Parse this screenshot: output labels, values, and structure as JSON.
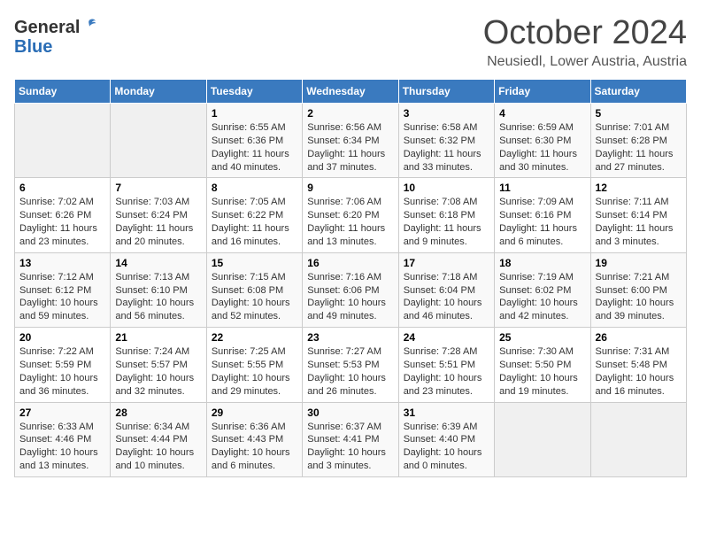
{
  "header": {
    "logo_general": "General",
    "logo_blue": "Blue",
    "month_title": "October 2024",
    "location": "Neusiedl, Lower Austria, Austria"
  },
  "weekdays": [
    "Sunday",
    "Monday",
    "Tuesday",
    "Wednesday",
    "Thursday",
    "Friday",
    "Saturday"
  ],
  "weeks": [
    [
      {
        "day": "",
        "sunrise": "",
        "sunset": "",
        "daylight": ""
      },
      {
        "day": "",
        "sunrise": "",
        "sunset": "",
        "daylight": ""
      },
      {
        "day": "1",
        "sunrise": "Sunrise: 6:55 AM",
        "sunset": "Sunset: 6:36 PM",
        "daylight": "Daylight: 11 hours and 40 minutes."
      },
      {
        "day": "2",
        "sunrise": "Sunrise: 6:56 AM",
        "sunset": "Sunset: 6:34 PM",
        "daylight": "Daylight: 11 hours and 37 minutes."
      },
      {
        "day": "3",
        "sunrise": "Sunrise: 6:58 AM",
        "sunset": "Sunset: 6:32 PM",
        "daylight": "Daylight: 11 hours and 33 minutes."
      },
      {
        "day": "4",
        "sunrise": "Sunrise: 6:59 AM",
        "sunset": "Sunset: 6:30 PM",
        "daylight": "Daylight: 11 hours and 30 minutes."
      },
      {
        "day": "5",
        "sunrise": "Sunrise: 7:01 AM",
        "sunset": "Sunset: 6:28 PM",
        "daylight": "Daylight: 11 hours and 27 minutes."
      }
    ],
    [
      {
        "day": "6",
        "sunrise": "Sunrise: 7:02 AM",
        "sunset": "Sunset: 6:26 PM",
        "daylight": "Daylight: 11 hours and 23 minutes."
      },
      {
        "day": "7",
        "sunrise": "Sunrise: 7:03 AM",
        "sunset": "Sunset: 6:24 PM",
        "daylight": "Daylight: 11 hours and 20 minutes."
      },
      {
        "day": "8",
        "sunrise": "Sunrise: 7:05 AM",
        "sunset": "Sunset: 6:22 PM",
        "daylight": "Daylight: 11 hours and 16 minutes."
      },
      {
        "day": "9",
        "sunrise": "Sunrise: 7:06 AM",
        "sunset": "Sunset: 6:20 PM",
        "daylight": "Daylight: 11 hours and 13 minutes."
      },
      {
        "day": "10",
        "sunrise": "Sunrise: 7:08 AM",
        "sunset": "Sunset: 6:18 PM",
        "daylight": "Daylight: 11 hours and 9 minutes."
      },
      {
        "day": "11",
        "sunrise": "Sunrise: 7:09 AM",
        "sunset": "Sunset: 6:16 PM",
        "daylight": "Daylight: 11 hours and 6 minutes."
      },
      {
        "day": "12",
        "sunrise": "Sunrise: 7:11 AM",
        "sunset": "Sunset: 6:14 PM",
        "daylight": "Daylight: 11 hours and 3 minutes."
      }
    ],
    [
      {
        "day": "13",
        "sunrise": "Sunrise: 7:12 AM",
        "sunset": "Sunset: 6:12 PM",
        "daylight": "Daylight: 10 hours and 59 minutes."
      },
      {
        "day": "14",
        "sunrise": "Sunrise: 7:13 AM",
        "sunset": "Sunset: 6:10 PM",
        "daylight": "Daylight: 10 hours and 56 minutes."
      },
      {
        "day": "15",
        "sunrise": "Sunrise: 7:15 AM",
        "sunset": "Sunset: 6:08 PM",
        "daylight": "Daylight: 10 hours and 52 minutes."
      },
      {
        "day": "16",
        "sunrise": "Sunrise: 7:16 AM",
        "sunset": "Sunset: 6:06 PM",
        "daylight": "Daylight: 10 hours and 49 minutes."
      },
      {
        "day": "17",
        "sunrise": "Sunrise: 7:18 AM",
        "sunset": "Sunset: 6:04 PM",
        "daylight": "Daylight: 10 hours and 46 minutes."
      },
      {
        "day": "18",
        "sunrise": "Sunrise: 7:19 AM",
        "sunset": "Sunset: 6:02 PM",
        "daylight": "Daylight: 10 hours and 42 minutes."
      },
      {
        "day": "19",
        "sunrise": "Sunrise: 7:21 AM",
        "sunset": "Sunset: 6:00 PM",
        "daylight": "Daylight: 10 hours and 39 minutes."
      }
    ],
    [
      {
        "day": "20",
        "sunrise": "Sunrise: 7:22 AM",
        "sunset": "Sunset: 5:59 PM",
        "daylight": "Daylight: 10 hours and 36 minutes."
      },
      {
        "day": "21",
        "sunrise": "Sunrise: 7:24 AM",
        "sunset": "Sunset: 5:57 PM",
        "daylight": "Daylight: 10 hours and 32 minutes."
      },
      {
        "day": "22",
        "sunrise": "Sunrise: 7:25 AM",
        "sunset": "Sunset: 5:55 PM",
        "daylight": "Daylight: 10 hours and 29 minutes."
      },
      {
        "day": "23",
        "sunrise": "Sunrise: 7:27 AM",
        "sunset": "Sunset: 5:53 PM",
        "daylight": "Daylight: 10 hours and 26 minutes."
      },
      {
        "day": "24",
        "sunrise": "Sunrise: 7:28 AM",
        "sunset": "Sunset: 5:51 PM",
        "daylight": "Daylight: 10 hours and 23 minutes."
      },
      {
        "day": "25",
        "sunrise": "Sunrise: 7:30 AM",
        "sunset": "Sunset: 5:50 PM",
        "daylight": "Daylight: 10 hours and 19 minutes."
      },
      {
        "day": "26",
        "sunrise": "Sunrise: 7:31 AM",
        "sunset": "Sunset: 5:48 PM",
        "daylight": "Daylight: 10 hours and 16 minutes."
      }
    ],
    [
      {
        "day": "27",
        "sunrise": "Sunrise: 6:33 AM",
        "sunset": "Sunset: 4:46 PM",
        "daylight": "Daylight: 10 hours and 13 minutes."
      },
      {
        "day": "28",
        "sunrise": "Sunrise: 6:34 AM",
        "sunset": "Sunset: 4:44 PM",
        "daylight": "Daylight: 10 hours and 10 minutes."
      },
      {
        "day": "29",
        "sunrise": "Sunrise: 6:36 AM",
        "sunset": "Sunset: 4:43 PM",
        "daylight": "Daylight: 10 hours and 6 minutes."
      },
      {
        "day": "30",
        "sunrise": "Sunrise: 6:37 AM",
        "sunset": "Sunset: 4:41 PM",
        "daylight": "Daylight: 10 hours and 3 minutes."
      },
      {
        "day": "31",
        "sunrise": "Sunrise: 6:39 AM",
        "sunset": "Sunset: 4:40 PM",
        "daylight": "Daylight: 10 hours and 0 minutes."
      },
      {
        "day": "",
        "sunrise": "",
        "sunset": "",
        "daylight": ""
      },
      {
        "day": "",
        "sunrise": "",
        "sunset": "",
        "daylight": ""
      }
    ]
  ]
}
